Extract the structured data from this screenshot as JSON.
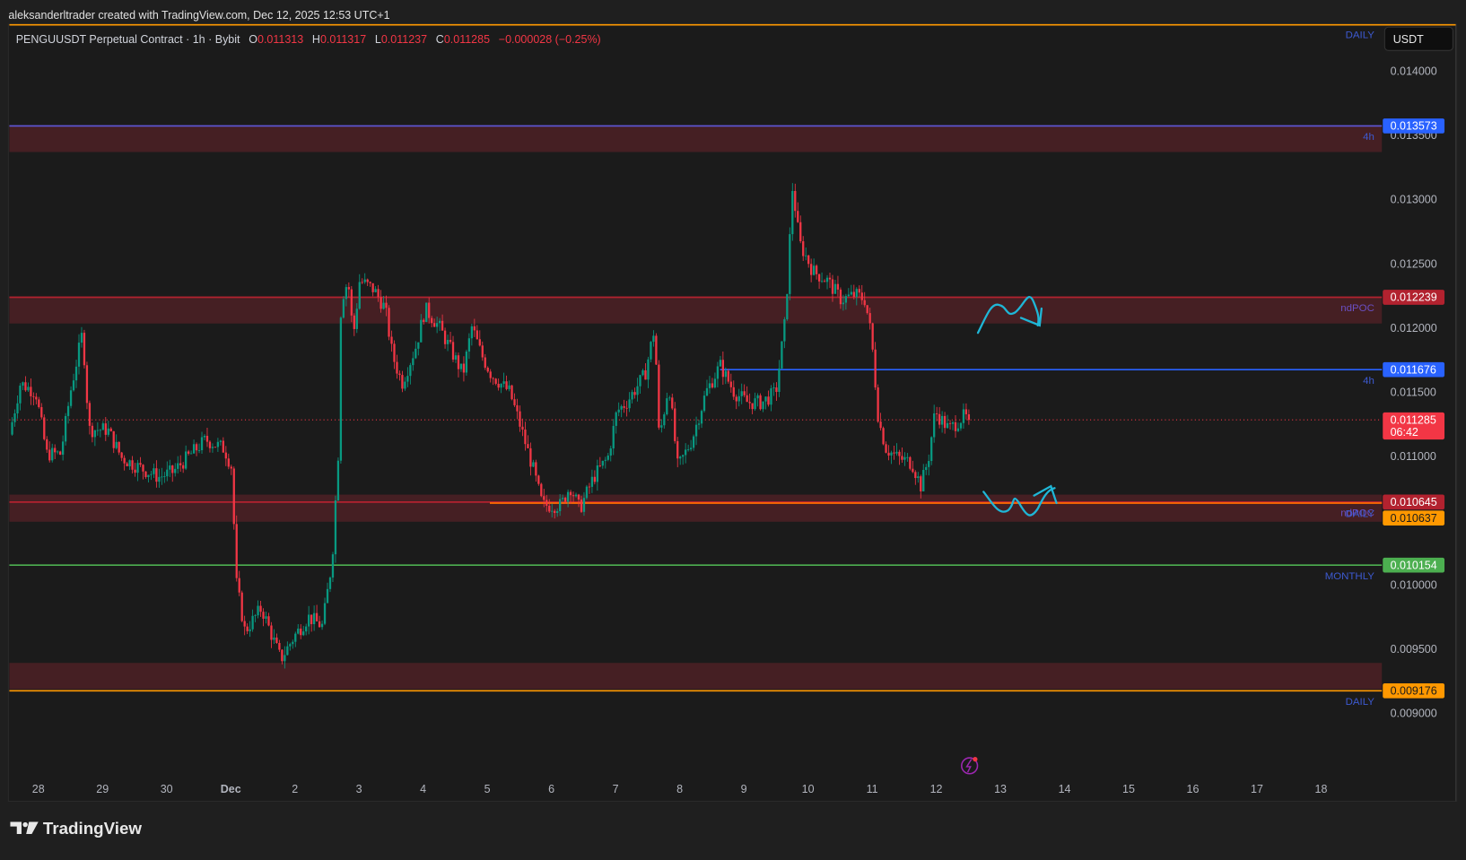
{
  "header": {
    "attribution": "aleksanderltrader created with TradingView.com, Dec 12, 2025 12:53 UTC+1"
  },
  "legend": {
    "symbol": "PENGUUSDT Perpetual Contract · 1h · Bybit",
    "o_label": "O",
    "o_value": "0.011313",
    "h_label": "H",
    "h_value": "0.011317",
    "l_label": "L",
    "l_value": "0.011237",
    "c_label": "C",
    "c_value": "0.011285",
    "change": "−0.000028 (−0.25%)"
  },
  "currency_button": "USDT",
  "branding": "TradingView",
  "colors": {
    "bg": "#1b1b1b",
    "up": "#089981",
    "down": "#f23645",
    "zone": "#4a2025",
    "blue_line": "#2962ff",
    "purple_line": "#5b57d9",
    "red_line": "#b2222f",
    "orange_line": "#ff9800",
    "orange_line2": "#ff6d00",
    "green_line": "#4caf50",
    "label_blue": "#3d5ad1",
    "label_purple": "#6a4fc2",
    "drawing": "#1fb6d6"
  },
  "chart_data": {
    "type": "candlestick",
    "title": "PENGUUSDT Perpetual Contract · 1h · Bybit",
    "interval": "1h",
    "x_unit": "days since Nov 28 00:00",
    "xlim": [
      -0.45,
      21.3
    ],
    "ylim": [
      0.00881,
      0.01436
    ],
    "x_ticks": [
      {
        "day": 0,
        "label": "28"
      },
      {
        "day": 1,
        "label": "29"
      },
      {
        "day": 2,
        "label": "30"
      },
      {
        "day": 3,
        "label": "Dec"
      },
      {
        "day": 4,
        "label": "2"
      },
      {
        "day": 5,
        "label": "3"
      },
      {
        "day": 6,
        "label": "4"
      },
      {
        "day": 7,
        "label": "5"
      },
      {
        "day": 8,
        "label": "6"
      },
      {
        "day": 9,
        "label": "7"
      },
      {
        "day": 10,
        "label": "8"
      },
      {
        "day": 11,
        "label": "9"
      },
      {
        "day": 12,
        "label": "10"
      },
      {
        "day": 13,
        "label": "11"
      },
      {
        "day": 14,
        "label": "12"
      },
      {
        "day": 15,
        "label": "13"
      },
      {
        "day": 16,
        "label": "14"
      },
      {
        "day": 17,
        "label": "15"
      },
      {
        "day": 18,
        "label": "16"
      },
      {
        "day": 19,
        "label": "17"
      },
      {
        "day": 20,
        "label": "18"
      }
    ],
    "y_ticks": [
      "0.014000",
      "0.013500",
      "0.013000",
      "0.012500",
      "0.012000",
      "0.011500",
      "0.011000",
      "0.010000",
      "0.009500",
      "0.009000"
    ],
    "approx_price_path": [
      [
        -0.45,
        0.01117
      ],
      [
        -0.28,
        0.01157
      ],
      [
        -0.04,
        0.0115
      ],
      [
        0.13,
        0.01102
      ],
      [
        0.35,
        0.01102
      ],
      [
        0.5,
        0.0115
      ],
      [
        0.69,
        0.01197
      ],
      [
        0.79,
        0.01121
      ],
      [
        1.08,
        0.01121
      ],
      [
        1.3,
        0.01099
      ],
      [
        1.59,
        0.01091
      ],
      [
        1.88,
        0.01084
      ],
      [
        2.1,
        0.01088
      ],
      [
        2.32,
        0.01099
      ],
      [
        2.61,
        0.01113
      ],
      [
        2.9,
        0.01106
      ],
      [
        3.02,
        0.01091
      ],
      [
        3.08,
        0.01004
      ],
      [
        3.22,
        0.00964
      ],
      [
        3.48,
        0.00982
      ],
      [
        3.78,
        0.00942
      ],
      [
        3.99,
        0.0096
      ],
      [
        4.21,
        0.00975
      ],
      [
        4.43,
        0.00968
      ],
      [
        4.58,
        0.01019
      ],
      [
        4.68,
        0.01106
      ],
      [
        4.72,
        0.01222
      ],
      [
        4.83,
        0.01237
      ],
      [
        4.91,
        0.01193
      ],
      [
        5.01,
        0.01237
      ],
      [
        5.23,
        0.0123
      ],
      [
        5.41,
        0.01215
      ],
      [
        5.52,
        0.01179
      ],
      [
        5.67,
        0.01157
      ],
      [
        5.89,
        0.01186
      ],
      [
        6.03,
        0.01215
      ],
      [
        6.25,
        0.01201
      ],
      [
        6.47,
        0.01179
      ],
      [
        6.62,
        0.01164
      ],
      [
        6.76,
        0.01201
      ],
      [
        6.91,
        0.01179
      ],
      [
        7.06,
        0.01164
      ],
      [
        7.35,
        0.0115
      ],
      [
        7.49,
        0.01128
      ],
      [
        7.71,
        0.01091
      ],
      [
        7.86,
        0.01062
      ],
      [
        8.15,
        0.01062
      ],
      [
        8.29,
        0.01077
      ],
      [
        8.44,
        0.01059
      ],
      [
        8.66,
        0.01084
      ],
      [
        8.88,
        0.01099
      ],
      [
        9.02,
        0.01135
      ],
      [
        9.17,
        0.01142
      ],
      [
        9.46,
        0.01164
      ],
      [
        9.61,
        0.01201
      ],
      [
        9.68,
        0.01113
      ],
      [
        9.83,
        0.01157
      ],
      [
        9.97,
        0.01091
      ],
      [
        10.19,
        0.01113
      ],
      [
        10.41,
        0.0115
      ],
      [
        10.63,
        0.01171
      ],
      [
        10.85,
        0.0115
      ],
      [
        11.06,
        0.01142
      ],
      [
        11.28,
        0.01142
      ],
      [
        11.5,
        0.0115
      ],
      [
        11.65,
        0.01208
      ],
      [
        11.76,
        0.0131
      ],
      [
        11.87,
        0.01266
      ],
      [
        12.08,
        0.01244
      ],
      [
        12.3,
        0.01237
      ],
      [
        12.52,
        0.01222
      ],
      [
        12.74,
        0.01226
      ],
      [
        12.89,
        0.01222
      ],
      [
        12.99,
        0.01193
      ],
      [
        13.1,
        0.01128
      ],
      [
        13.22,
        0.01106
      ],
      [
        13.4,
        0.01099
      ],
      [
        13.62,
        0.01095
      ],
      [
        13.76,
        0.01077
      ],
      [
        13.88,
        0.01099
      ],
      [
        13.98,
        0.01135
      ],
      [
        14.2,
        0.01121
      ],
      [
        14.42,
        0.01131
      ],
      [
        14.52,
        0.011285
      ]
    ],
    "zones": [
      {
        "name": "4h zone",
        "from": 0.01337,
        "to": 0.01358
      },
      {
        "name": "ndPOC zone upper",
        "from": 0.012035,
        "to": 0.012246
      },
      {
        "name": "ndPOC zone lower",
        "from": 0.010492,
        "to": 0.010703
      },
      {
        "name": "daily zone",
        "from": 0.009189,
        "to": 0.009393
      }
    ],
    "levels": [
      {
        "name": "daily-top",
        "price": 0.01436,
        "color": "orange_line",
        "start_day": null,
        "badge": null,
        "tag": "DAILY",
        "tag_color": "label_blue"
      },
      {
        "name": "4h-upper",
        "price": 0.013573,
        "color": "purple_line",
        "start_day": null,
        "badge": "0.013573",
        "badge_color": "blue_line",
        "tag": "4h",
        "tag_color": "label_blue"
      },
      {
        "name": "ndpoc-upper",
        "price": 0.012239,
        "color": "red_line",
        "start_day": null,
        "badge": "0.012239",
        "badge_color": "red_line",
        "tag": "ndPOC",
        "tag_color": "label_purple"
      },
      {
        "name": "4h-lower",
        "price": 0.011676,
        "color": "blue_line",
        "start_day": 10.63,
        "badge": "0.011676",
        "badge_color": "blue_line",
        "tag": "4h",
        "tag_color": "label_blue"
      },
      {
        "name": "ndpoc-lower",
        "price": 0.010645,
        "color": "red_line",
        "start_day": null,
        "badge": "0.010645",
        "badge_color": "red_line",
        "tag": "ndPOC",
        "tag_color": "label_purple"
      },
      {
        "name": "daily-mid",
        "price": 0.010637,
        "color": "orange_line2",
        "start_day": 7.04,
        "badge": "0.010637",
        "badge_color": "orange_line",
        "tag": "DAILY",
        "tag_color": "label_blue"
      },
      {
        "name": "monthly",
        "price": 0.010154,
        "color": "green_line",
        "start_day": null,
        "badge": "0.010154",
        "badge_color": "green_line",
        "tag": "MONTHLY",
        "tag_color": "label_blue"
      },
      {
        "name": "daily-bottom",
        "price": 0.009176,
        "color": "orange_line",
        "start_day": null,
        "badge": "0.009176",
        "badge_color": "orange_line",
        "tag": "DAILY",
        "tag_color": "label_blue"
      }
    ],
    "last_price": {
      "price": 0.011285,
      "label": "0.011285",
      "countdown": "06:42"
    }
  }
}
